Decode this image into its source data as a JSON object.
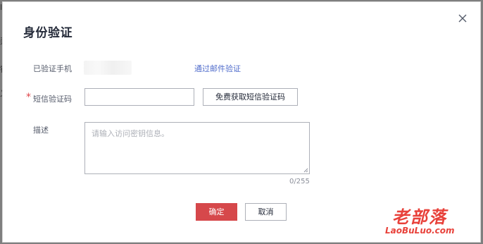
{
  "dialog": {
    "title": "身份验证"
  },
  "background": {
    "edge_glyphs": [
      "I",
      "弄",
      "锐",
      "乂"
    ]
  },
  "form": {
    "phone": {
      "label": "已验证手机",
      "switch_link": "通过邮件验证"
    },
    "sms_code": {
      "required_mark": "*",
      "label": "短信验证码",
      "value": "",
      "get_code_button": "免费获取短信验证码"
    },
    "description": {
      "label": "描述",
      "placeholder": "请输入访问密钥信息。",
      "value": "",
      "counter": "0/255"
    }
  },
  "actions": {
    "confirm": "确定",
    "cancel": "取消"
  },
  "watermark": {
    "title": "老部落",
    "subtitle": "LaoBuLuo.com"
  },
  "colors": {
    "primary_button": "#d6484b",
    "link": "#526ecc",
    "required": "#e0454a",
    "watermark": "#e8413a"
  }
}
